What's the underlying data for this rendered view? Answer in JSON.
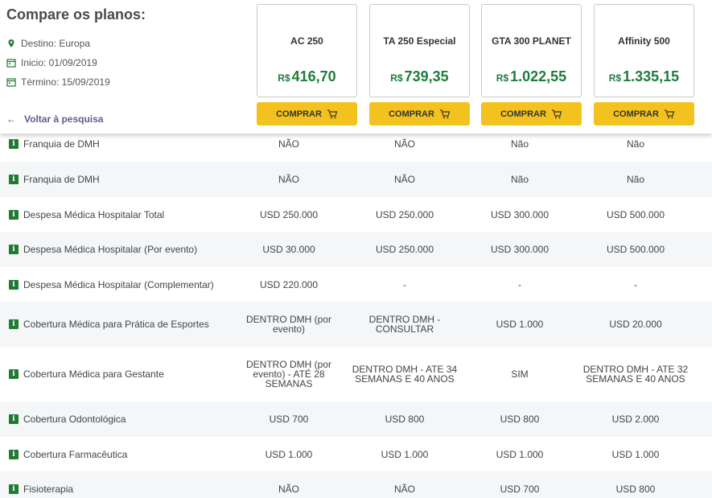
{
  "header": {
    "title": "Compare os planos:",
    "destination": "Destino: Europa",
    "start": "Inicio: 01/09/2019",
    "end": "Término: 15/09/2019",
    "back": "Voltar à pesquisa"
  },
  "plans": [
    {
      "name": "AC 250",
      "currency": "R$",
      "price": "416,70",
      "buy": "COMPRAR"
    },
    {
      "name": "TA 250 Especial",
      "currency": "R$",
      "price": "739,35",
      "buy": "COMPRAR"
    },
    {
      "name": "GTA 300 PLANET",
      "currency": "R$",
      "price": "1.022,55",
      "buy": "COMPRAR"
    },
    {
      "name": "Affinity 500",
      "currency": "R$",
      "price": "1.335,15",
      "buy": "COMPRAR"
    }
  ],
  "rows": [
    {
      "label": "Franquia de DMH",
      "values": [
        "NÃO",
        "NÃO",
        "Não",
        "Não"
      ]
    },
    {
      "label": "Franquia de DMH",
      "values": [
        "NÃO",
        "NÃO",
        "Não",
        "Não"
      ]
    },
    {
      "label": "Despesa Médica Hospitalar Total",
      "values": [
        "USD 250.000",
        "USD 250.000",
        "USD 300.000",
        "USD 500.000"
      ]
    },
    {
      "label": "Despesa Médica Hospitalar (Por evento)",
      "values": [
        "USD 30.000",
        "USD 250.000",
        "USD 300.000",
        "USD 500.000"
      ]
    },
    {
      "label": "Despesa Médica Hospitalar (Complementar)",
      "values": [
        "USD 220.000",
        "-",
        "-",
        "-"
      ]
    },
    {
      "label": "Cobertura Médica para Prática de Esportes",
      "values": [
        "DENTRO DMH (por evento)",
        "DENTRO DMH - CONSULTAR",
        "USD 1.000",
        "USD 20.000"
      ]
    },
    {
      "label": "Cobertura Médica para Gestante",
      "values": [
        "DENTRO DMH (por evento) - ATÉ 28 SEMANAS",
        "DENTRO DMH - ATE 34 SEMANAS E 40 ANOS",
        "SIM",
        "DENTRO DMH - ATE 32 SEMANAS E 40 ANOS"
      ]
    },
    {
      "label": "Cobertura Odontológica",
      "values": [
        "USD 700",
        "USD 800",
        "USD 800",
        "USD 2.000"
      ]
    },
    {
      "label": "Cobertura Farmacêutica",
      "values": [
        "USD 1.000",
        "USD 1.000",
        "USD 1.000",
        "USD 1.000"
      ]
    },
    {
      "label": "Fisioterapia",
      "values": [
        "NÃO",
        "NÃO",
        "USD 700",
        "USD 800"
      ]
    }
  ],
  "colors": {
    "accent": "#f4c21f",
    "price": "#1e7d3c",
    "badge": "#1f7a34",
    "back_link": "#5b5e8a"
  }
}
